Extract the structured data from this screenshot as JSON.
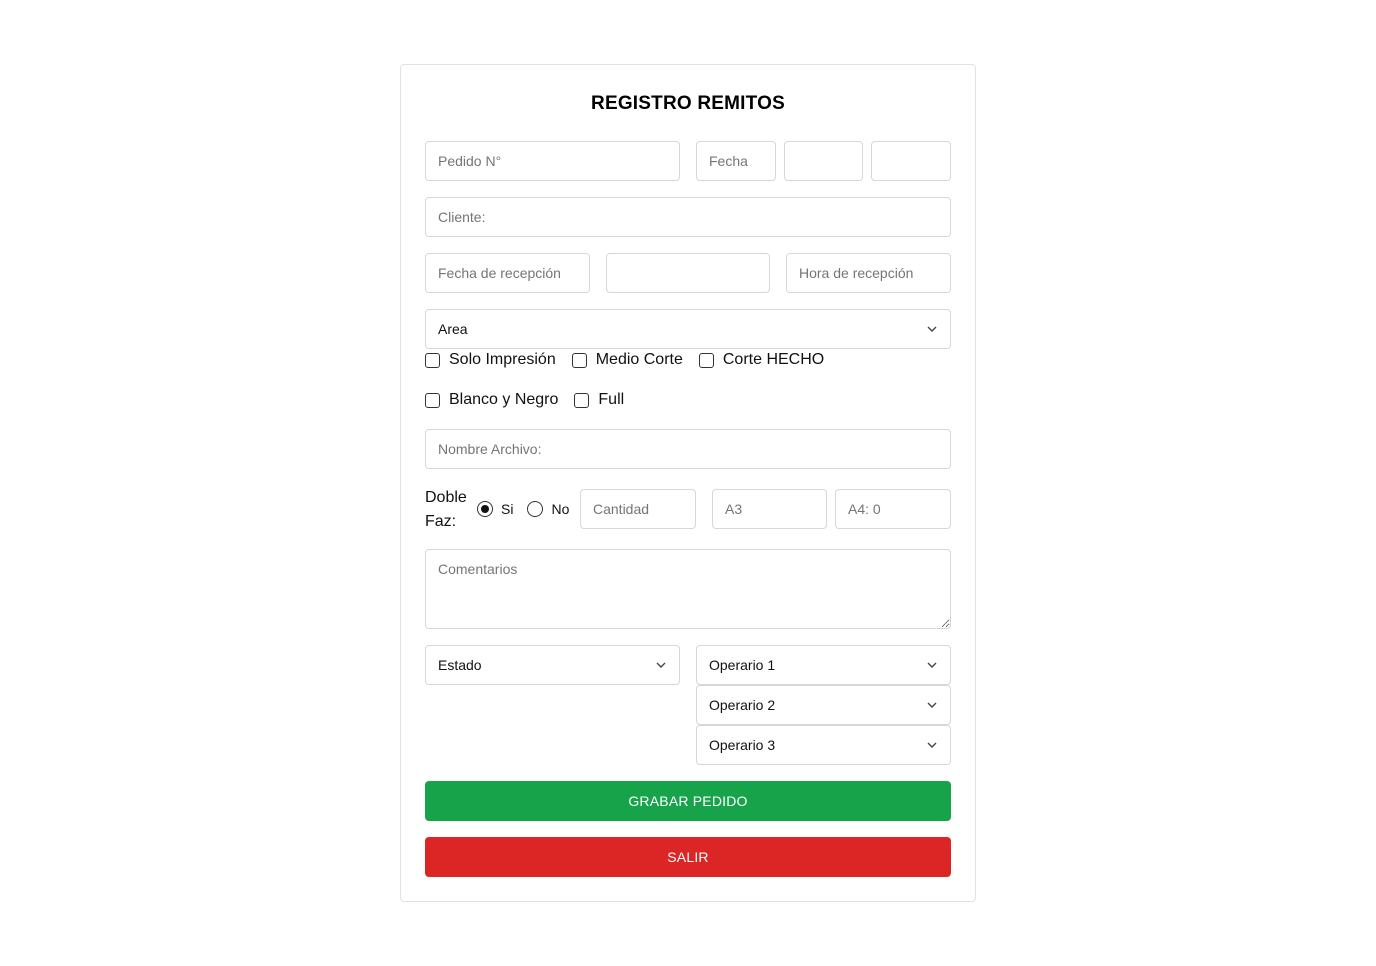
{
  "form": {
    "title": "REGISTRO REMITOS",
    "pedido_placeholder": "Pedido N°",
    "fecha_placeholder": "Fecha",
    "cliente_placeholder": "Cliente:",
    "fecha_recepcion_placeholder": "Fecha de recepción",
    "hora_recepcion_placeholder": "Hora de recepción",
    "area_select": "Area",
    "checkboxes": {
      "solo_impresion": "Solo Impresión",
      "medio_corte": "Medio Corte",
      "corte_hecho": "Corte HECHO",
      "blanco_negro": "Blanco y Negro",
      "full": "Full"
    },
    "nombre_archivo_placeholder": "Nombre Archivo:",
    "doble_faz_line1": "Doble",
    "doble_faz_line2": "Faz:",
    "radio_si": "Si",
    "radio_no": "No",
    "doble_faz_selected": "Si",
    "cantidad_placeholder": "Cantidad",
    "a3_placeholder": "A3",
    "a4_placeholder": "A4: 0",
    "comentarios_placeholder": "Comentarios",
    "estado_select": "Estado",
    "operario1_select": "Operario 1",
    "operario2_select": "Operario 2",
    "operario3_select": "Operario 3",
    "grabar_button": "GRABAR PEDIDO",
    "salir_button": "SALIR"
  },
  "colors": {
    "grabar": "#16a34a",
    "salir": "#dc2626"
  },
  "icons": {
    "select_arrow": "chevron-down-icon"
  }
}
